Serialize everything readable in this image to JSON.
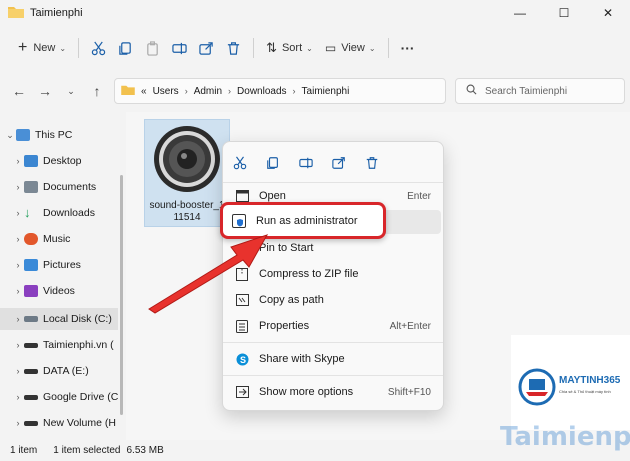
{
  "window": {
    "title": "Taimienphi"
  },
  "toolbar": {
    "new_label": "New",
    "sort_label": "Sort",
    "view_label": "View",
    "more_label": "···"
  },
  "address": {
    "separator": "«",
    "crumbs": [
      "Users",
      "Admin",
      "Downloads",
      "Taimienphi"
    ]
  },
  "search": {
    "placeholder": "Search Taimienphi"
  },
  "sidebar": {
    "items": [
      {
        "label": "This PC"
      },
      {
        "label": "Desktop"
      },
      {
        "label": "Documents"
      },
      {
        "label": "Downloads"
      },
      {
        "label": "Music"
      },
      {
        "label": "Pictures"
      },
      {
        "label": "Videos"
      },
      {
        "label": "Local Disk (C:)"
      },
      {
        "label": "Taimienphi.vn ("
      },
      {
        "label": "DATA (E:)"
      },
      {
        "label": "Google Drive (C"
      },
      {
        "label": "New Volume (H"
      }
    ]
  },
  "file": {
    "name_line1": "sound-booster_1",
    "name_line2": "11514"
  },
  "context_menu": {
    "items": [
      {
        "label": "Open",
        "shortcut": "Enter"
      },
      {
        "label": "Run as administrator",
        "shortcut": ""
      },
      {
        "label": "Pin to Start",
        "shortcut": ""
      },
      {
        "label": "Compress to ZIP file",
        "shortcut": ""
      },
      {
        "label": "Copy as path",
        "shortcut": ""
      },
      {
        "label": "Properties",
        "shortcut": "Alt+Enter"
      },
      {
        "label": "Share with Skype",
        "shortcut": ""
      },
      {
        "label": "Show more options",
        "shortcut": "Shift+F10"
      }
    ]
  },
  "status": {
    "count": "1 item",
    "selection": "1 item selected",
    "size": "6.53 MB"
  },
  "watermark": {
    "brand": "MAYTINH365",
    "tagline": "Chia sẻ & Thủ thuật máy tính",
    "site": "Taimienphi"
  },
  "colors": {
    "accent_red": "#d8262a",
    "selection_blue": "#cfe1f0",
    "folder_yellow": "#f2c14e"
  }
}
